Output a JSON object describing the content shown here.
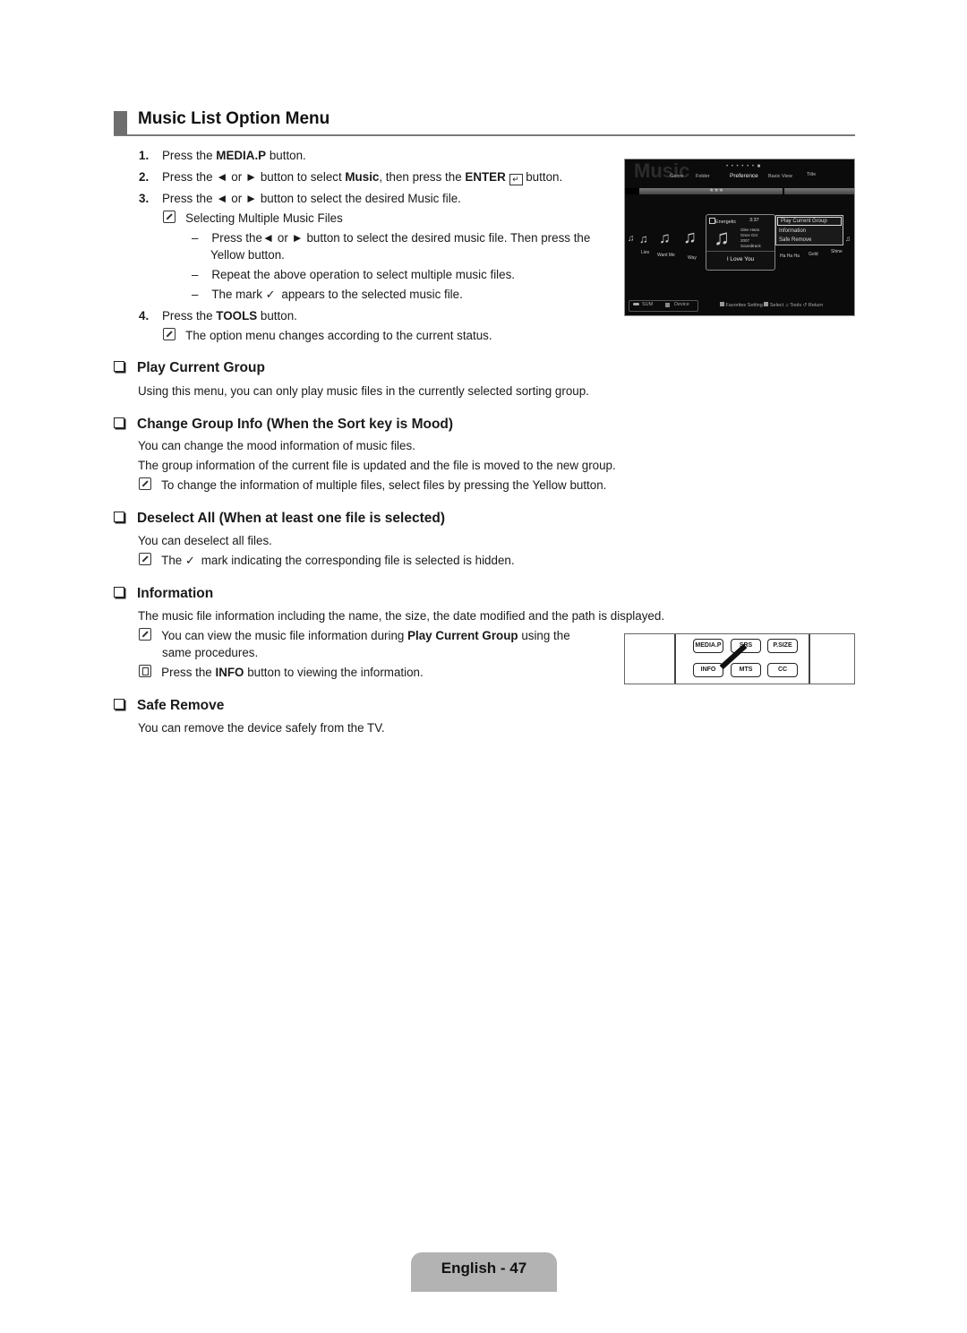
{
  "page_title": "Music List Option Menu",
  "steps": [
    {
      "num": "1.",
      "pre": "Press the ",
      "bold": "MEDIA.P",
      "post": " button."
    },
    {
      "num": "2.",
      "pre": "Press the ◄ or ► button to select ",
      "bold": "Music",
      "mid": ", then press the ",
      "bold2": "ENTER",
      "post": " button."
    },
    {
      "num": "3.",
      "text": "Press the ◄ or ► button to select the desired Music file."
    },
    {
      "num": "4.",
      "pre": "Press the ",
      "bold": "TOOLS",
      "post": " button."
    }
  ],
  "step3_note": "Selecting Multiple Music Files",
  "step3_bullets": [
    "Press the◄ or ► button to select the desired music file. Then press the",
    "Yellow button.",
    "Repeat the above operation to select multiple music files.",
    "The mark",
    "appears to the selected music file."
  ],
  "step4_note": "The option menu changes according to the current status.",
  "sections": {
    "play_current_group": {
      "heading": "Play Current Group",
      "body": "Using this menu, you can only play music files in the currently selected sorting group."
    },
    "change_group_info": {
      "heading": "Change Group Info (When the Sort key is Mood)",
      "body1": "You can change the mood information of music files.",
      "body2": "The group information of the current file is updated and the file is moved to the new group.",
      "note": "To change the information of multiple files, select files by pressing the Yellow button."
    },
    "deselect_all": {
      "heading": "Deselect All (When at least one file is selected)",
      "body": "You can deselect all files.",
      "note_pre": "The",
      "note_post": "mark indicating the corresponding file is selected is hidden."
    },
    "information": {
      "heading": "Information",
      "body": "The music file information including the name, the size, the date modified and the path is displayed.",
      "note1_pre": "You can view the music file information during ",
      "note1_bold": "Play Current Group",
      "note1_post": " using the",
      "note1_line2": "same procedures.",
      "note2_pre": "Press the ",
      "note2_bold": "INFO",
      "note2_post": " button to viewing the information."
    },
    "safe_remove": {
      "heading": "Safe Remove",
      "body": "You can remove the device safely from the TV."
    }
  },
  "tv_screen": {
    "title": "Music",
    "page_dots": "• • • • • • ■",
    "sort_tabs": [
      "Genre",
      "Folder",
      "Preference",
      "Basic View",
      "Title"
    ],
    "active_sort": "Preference",
    "rating": "★★★",
    "tracks": [
      "Lies",
      "Want Me",
      "Way",
      "Ha Ha Ha",
      "Gold",
      "Shine"
    ],
    "card": {
      "mood": "Energetic",
      "duration": "3:37",
      "artist": "Glen Hans",
      "album": "Once Oct",
      "year": "2007",
      "genre": "Soundtrack",
      "song": "I Love You"
    },
    "option_menu": [
      "Play Current Group",
      "Information",
      "Safe Remove"
    ],
    "selected_option": "Play Current Group",
    "footer_left": [
      "SUM",
      "Device"
    ],
    "footer_right": [
      "Favorites Setting",
      "Select",
      "Tools",
      "Return"
    ]
  },
  "remote": {
    "top_buttons": [
      "MEDIA.P",
      "SRS",
      "P.SIZE"
    ],
    "bottom_buttons": [
      "INFO",
      "MTS",
      "CC"
    ]
  },
  "footer": "English - 47"
}
